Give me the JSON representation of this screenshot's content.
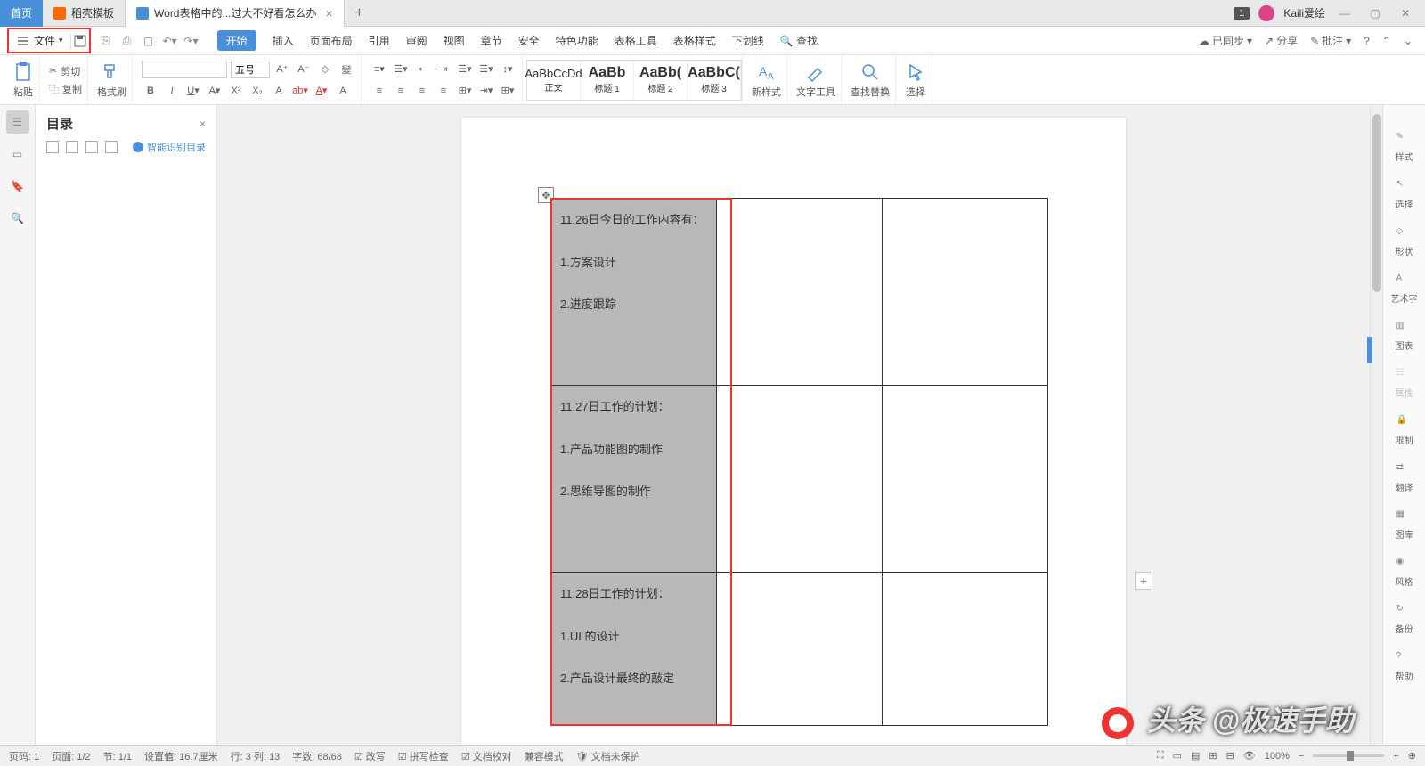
{
  "titlebar": {
    "tabs": [
      {
        "label": "首页",
        "type": "home"
      },
      {
        "label": "稻壳模板",
        "type": "docer"
      },
      {
        "label": "Word表格中的...过大不好看怎么办",
        "type": "doc",
        "active": true
      }
    ],
    "badge": "1",
    "user": "Kaili爱绘"
  },
  "menubar": {
    "file": "文件",
    "tabs": [
      "开始",
      "插入",
      "页面布局",
      "引用",
      "审阅",
      "视图",
      "章节",
      "安全",
      "特色功能",
      "表格工具",
      "表格样式",
      "下划线"
    ],
    "active": "开始",
    "search": "查找",
    "right": {
      "sync": "已同步",
      "share": "分享",
      "approve": "批注"
    }
  },
  "ribbon": {
    "paste": "粘贴",
    "cut": "剪切",
    "copy": "复制",
    "brush": "格式刷",
    "font_size": "五号",
    "styles": [
      {
        "preview": "AaBbCcDd",
        "name": "正文"
      },
      {
        "preview": "AaBb",
        "name": "标题 1",
        "bold": true
      },
      {
        "preview": "AaBb(",
        "name": "标题 2",
        "bold": true
      },
      {
        "preview": "AaBbC(",
        "name": "标题 3",
        "bold": true
      }
    ],
    "new_style": "新样式",
    "text_tool": "文字工具",
    "find_replace": "查找替换",
    "select": "选择"
  },
  "toc": {
    "title": "目录",
    "smart": "智能识别目录"
  },
  "table": {
    "rows": [
      {
        "lines": [
          "11.26日今日的工作内容有：",
          "1.方案设计",
          "2.进度跟踪"
        ]
      },
      {
        "lines": [
          "11.27日工作的计划：",
          "1.产品功能图的制作",
          "2.思维导图的制作"
        ]
      },
      {
        "lines": [
          "11.28日工作的计划：",
          "1.UI 的设计",
          "2.产品设计最终的敲定"
        ]
      }
    ]
  },
  "right_rail": [
    "样式",
    "选择",
    "形状",
    "艺术字",
    "图表",
    "属性",
    "限制",
    "翻译",
    "图库",
    "风格",
    "备份",
    "帮助"
  ],
  "statusbar": {
    "page": "页码: 1",
    "pages": "页面: 1/2",
    "section": "节: 1/1",
    "setval": "设置值: 16.7厘米",
    "line": "行: 3  列: 13",
    "words": "字数: 68/68",
    "edit": "改写",
    "spell": "拼写检查",
    "proof": "文档校对",
    "compat": "兼容模式",
    "protect": "文档未保护",
    "zoom": "100%"
  },
  "watermark": "头条 @极速手助"
}
